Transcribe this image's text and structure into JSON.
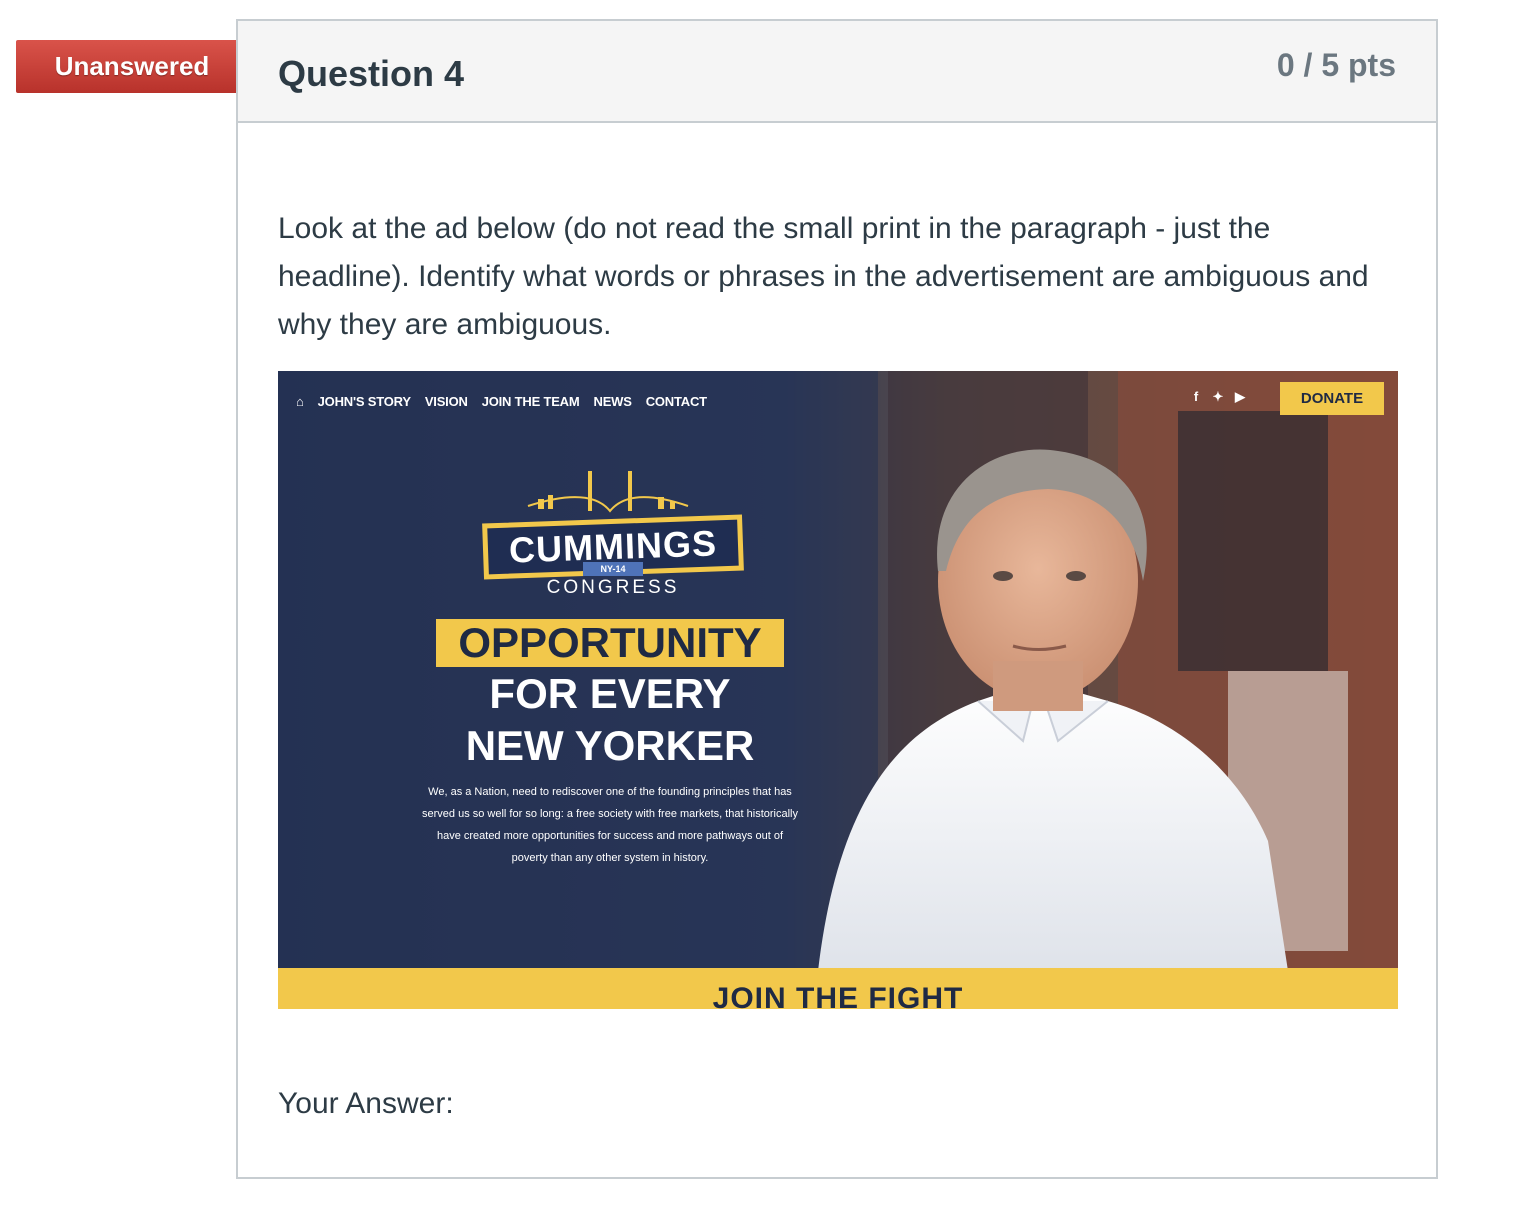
{
  "status_flag": {
    "label": "Unanswered",
    "color": "#c0392b"
  },
  "question": {
    "title": "Question 4",
    "points": "0 / 5 pts",
    "text": "Look at the ad below (do not read the small print in the paragraph - just the headline).  Identify what words or phrases in the advertisement are ambiguous and why they are ambiguous.",
    "answer_label": "Your Answer:"
  },
  "ad": {
    "nav": [
      "JOHN'S STORY",
      "VISION",
      "JOIN THE TEAM",
      "NEWS",
      "CONTACT"
    ],
    "social_icons": [
      "facebook-icon",
      "twitter-icon",
      "youtube-icon"
    ],
    "donate": "DONATE",
    "logo_name": "CUMMINGS",
    "logo_district": "NY-14",
    "logo_congress": "CONGRESS",
    "headline_1": "OPPORTUNITY",
    "headline_2": "FOR EVERY",
    "headline_3": "NEW YORKER",
    "small_print": "We, as a Nation, need to rediscover one of the founding principles that has served us so well for so long: a free society with free markets, that historically have created more opportunities for success and more pathways out of poverty than any other system in history.",
    "join": "JOIN THE FIGHT",
    "colors": {
      "navy": "#2a3757",
      "gold": "#f2c84b"
    }
  }
}
